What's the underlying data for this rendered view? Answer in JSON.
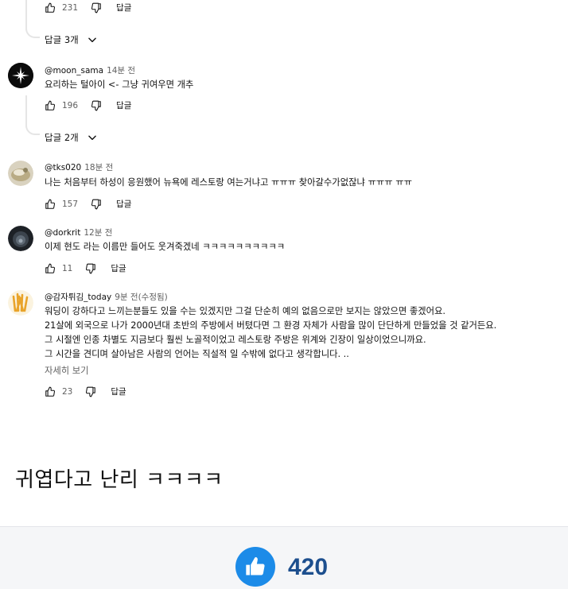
{
  "thread0": {
    "likes": "231",
    "reply_label": "답글",
    "replies_toggle": "답글 3개"
  },
  "comments": [
    {
      "author": "@moon_sama",
      "time": "14분 전",
      "lines": [
        "요리하는 털아이 <- 그냥 귀여우면 개추"
      ],
      "likes": "196",
      "reply_label": "답글",
      "replies_toggle": "답글 2개"
    },
    {
      "author": "@tks020",
      "time": "18분 전",
      "lines": [
        "나는 처음부터 하성이 응원했어 뉴욕에 레스토랑 여는거냐고 ㅠㅠㅠ 찾아갈수가없잖냐 ㅠㅠㅠ ㅠㅠ"
      ],
      "likes": "157",
      "reply_label": "답글"
    },
    {
      "author": "@dorkrit",
      "time": "12분 전",
      "lines": [
        "이제 현도 라는 이름만 들어도 웃겨죽겠네 ㅋㅋㅋㅋㅋㅋㅋㅋㅋㅋ"
      ],
      "likes": "11",
      "reply_label": "답글"
    },
    {
      "author": "@감자튀김_today",
      "time": "9분 전(수정됨)",
      "lines": [
        "워딩이 강하다고 느끼는분들도 있을 수는 있겠지만 그걸 단순히 예의 없음으로만 보지는 않았으면 좋겠어요.",
        "21살에 외국으로 나가 2000년대 초반의 주방에서 버텼다면 그 환경 자체가 사람을 많이 단단하게 만들었을 것 같거든요.",
        "그 시절엔 인종 차별도 지금보다 훨씬 노골적이었고 레스토랑 주방은 위계와 긴장이 일상이었으니까요.",
        "그 시간을 견디며 살아남은 사람의 언어는 직설적 일 수밖에 없다고 생각합니다. .."
      ],
      "read_more": "자세히 보기",
      "likes": "23",
      "reply_label": "답글"
    }
  ],
  "caption": "귀엽다고 난리 ㅋㅋㅋㅋ",
  "footer": {
    "like_total": "420"
  },
  "colors": {
    "like_button": "#1c8be8",
    "like_total": "#1d4f8e",
    "meta_text": "#606060"
  },
  "icons": {
    "like": "thumbs-up-icon",
    "dislike": "thumbs-down-icon",
    "chevron": "chevron-down-icon"
  }
}
